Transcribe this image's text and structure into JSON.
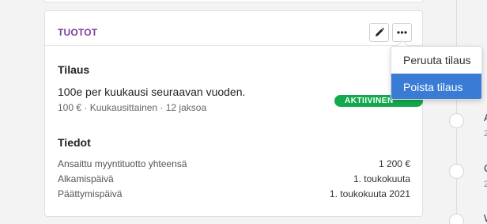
{
  "card": {
    "title": "TUOTOT",
    "edit_icon": "pencil-icon",
    "more_icon": "ellipsis-icon",
    "subscription_heading": "Tilaus",
    "plan_name": "100e per kuukausi seuraavan vuoden.",
    "plan_meta": "100 € · Kuukausittainen · 12 jaksoa",
    "status_badge": "AKTIIVINEN",
    "details_heading": "Tiedot",
    "details": [
      {
        "label": "Ansaittu myyntituotto yhteensä",
        "value": "1 200 €"
      },
      {
        "label": "Alkamispäivä",
        "value": "1. toukokuuta"
      },
      {
        "label": "Päättymispäivä",
        "value": "1. toukokuuta 2021"
      }
    ]
  },
  "dropdown": {
    "items": [
      {
        "label": "Peruuta tilaus",
        "highlighted": false
      },
      {
        "label": "Poista tilaus",
        "highlighted": true
      }
    ]
  },
  "timeline": {
    "items": [
      {
        "initial": "A",
        "sub": "2"
      },
      {
        "initial": "C",
        "sub": "2"
      },
      {
        "initial": "W",
        "sub": ""
      }
    ]
  },
  "colors": {
    "title_purple": "#7b3f99",
    "badge_green": "#13a94d",
    "menu_highlight": "#3a7bd5"
  }
}
